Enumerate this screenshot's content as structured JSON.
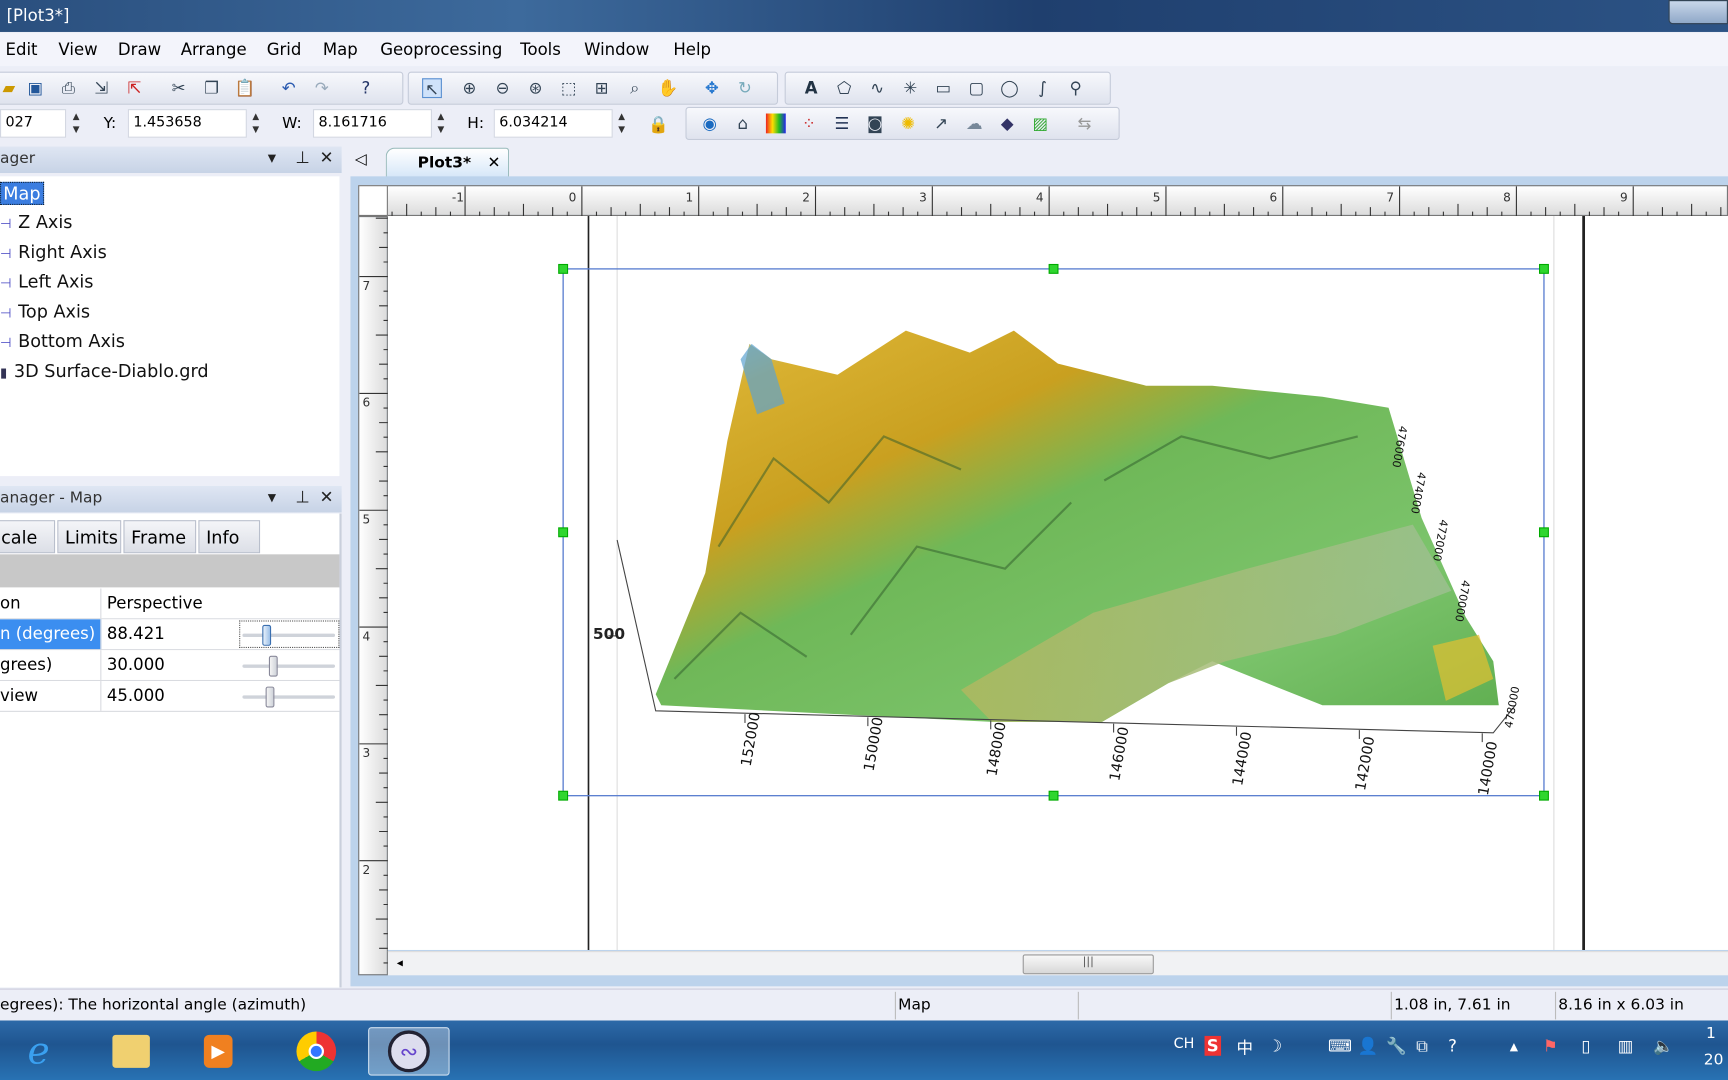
{
  "window": {
    "title": "[Plot3*]"
  },
  "menu": [
    "Edit",
    "View",
    "Draw",
    "Arrange",
    "Grid",
    "Map",
    "Geoprocessing",
    "Tools",
    "Window",
    "Help"
  ],
  "position_bar": {
    "x_value": "027",
    "y_label": "Y:",
    "y_value": "1.453658",
    "w_label": "W:",
    "w_value": "8.161716",
    "h_label": "H:",
    "h_value": "6.034214"
  },
  "object_manager": {
    "title": "ager",
    "items": [
      "Map",
      "Z Axis",
      "Right Axis",
      "Left Axis",
      "Top Axis",
      "Bottom Axis",
      "3D Surface-Diablo.grd"
    ]
  },
  "property_manager": {
    "title": "anager - Map",
    "tabs": [
      "cale",
      "Limits",
      "Frame",
      "Info"
    ],
    "rows": [
      {
        "key": "on",
        "value": "Perspective"
      },
      {
        "key": "n (degrees)",
        "value": "88.421",
        "slider": 0.27,
        "selected": true
      },
      {
        "key": "grees)",
        "value": "30.000",
        "slider": 0.33
      },
      {
        "key": " view",
        "value": "45.000",
        "slider": 0.3
      }
    ]
  },
  "doc_tab": {
    "label": "Plot3*",
    "close": "✕"
  },
  "ruler": {
    "h_labels": [
      "-1",
      "0",
      "1",
      "2",
      "3",
      "4",
      "5",
      "6",
      "7",
      "8",
      "9"
    ],
    "v_labels": [
      "7",
      "6",
      "5",
      "4",
      "3",
      "2"
    ]
  },
  "map": {
    "z_label": "500",
    "bottom_axis_labels": [
      "152000",
      "150000",
      "148000",
      "146000",
      "144000",
      "142000",
      "140000"
    ],
    "right_axis_labels": [
      "476000",
      "474000",
      "472000",
      "470000",
      "478000"
    ],
    "colors": {
      "high": "#4aa6e0",
      "mid": "#e0b020",
      "low": "#6fc060",
      "valley": "#a8b870"
    }
  },
  "status": {
    "help": "egrees): The horizontal angle (azimuth)",
    "object": "Map",
    "empty": "",
    "cursor": "1.08 in, 7.61 in",
    "size": "8.16 in x 6.03 in"
  },
  "taskbar": {
    "apps": [
      "internet-explorer",
      "file-explorer",
      "media-player",
      "chrome",
      "surfer"
    ],
    "tray_text": [
      "CH",
      "中"
    ],
    "clock": "1",
    "date": "20"
  }
}
